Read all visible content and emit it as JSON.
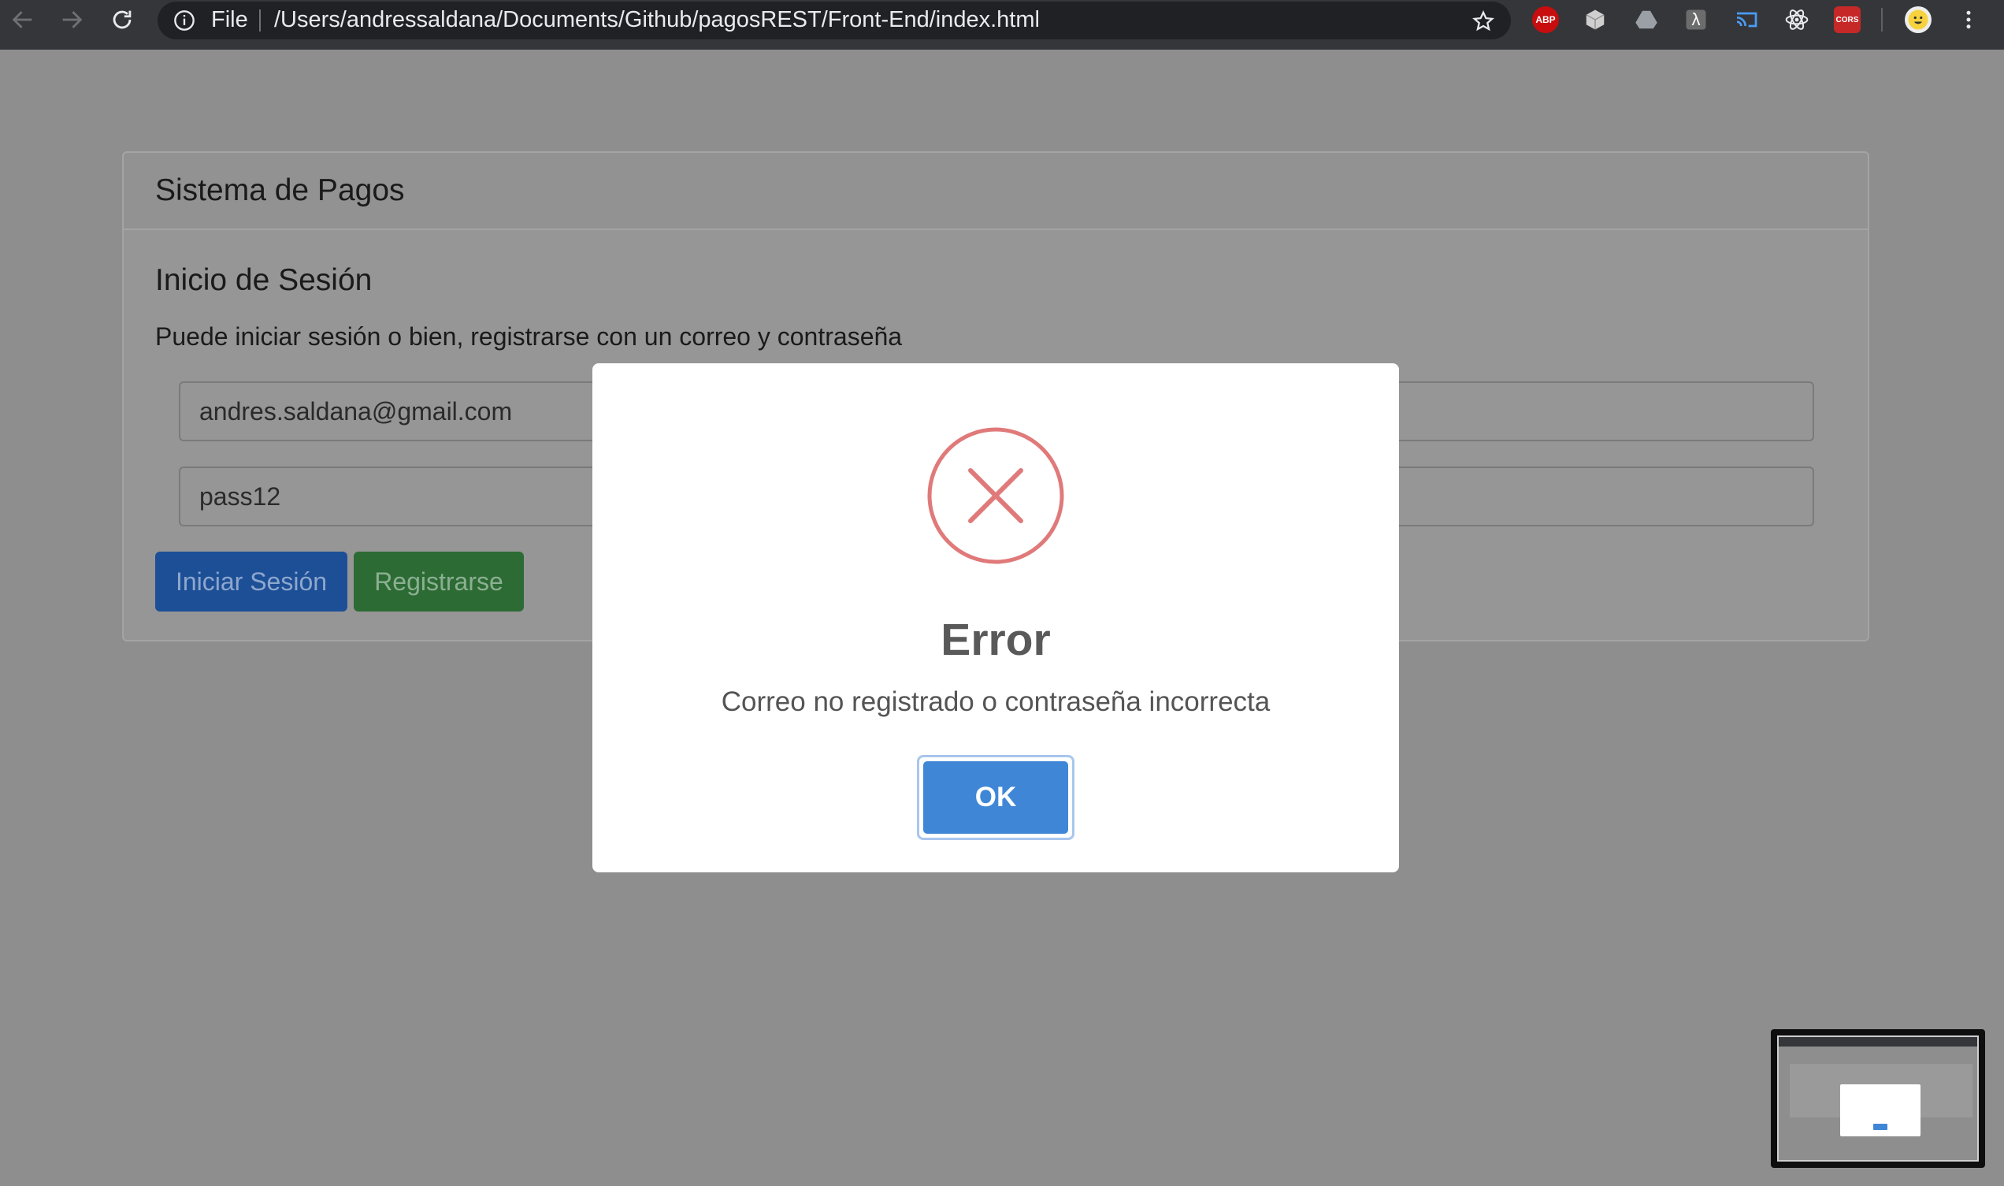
{
  "browser": {
    "scheme_label": "File",
    "url": "/Users/andressaldana/Documents/Github/pagosREST/Front-End/index.html",
    "extensions": [
      {
        "name": "adblock-plus",
        "label": "ABP"
      },
      {
        "name": "box-extension",
        "label": ""
      },
      {
        "name": "drive-extension",
        "label": ""
      },
      {
        "name": "lambda-extension",
        "label": "λ"
      },
      {
        "name": "cast-extension",
        "label": ""
      },
      {
        "name": "react-devtools",
        "label": ""
      },
      {
        "name": "cors-extension",
        "label": "CORS"
      }
    ]
  },
  "page": {
    "card_header": "Sistema de Pagos",
    "login_title": "Inicio de Sesión",
    "login_description": "Puede iniciar sesión o bien, registrarse con un correo y contraseña",
    "email_value": "andres.saldana@gmail.com",
    "password_value": "pass12",
    "login_button": "Iniciar Sesión",
    "register_button": "Registrarse"
  },
  "modal": {
    "title": "Error",
    "message": "Correo no registrado o contraseña incorrecta",
    "confirm_button": "OK",
    "icon": "error-x-icon",
    "icon_color": "#e07a7a",
    "button_color": "#3f87d6"
  }
}
